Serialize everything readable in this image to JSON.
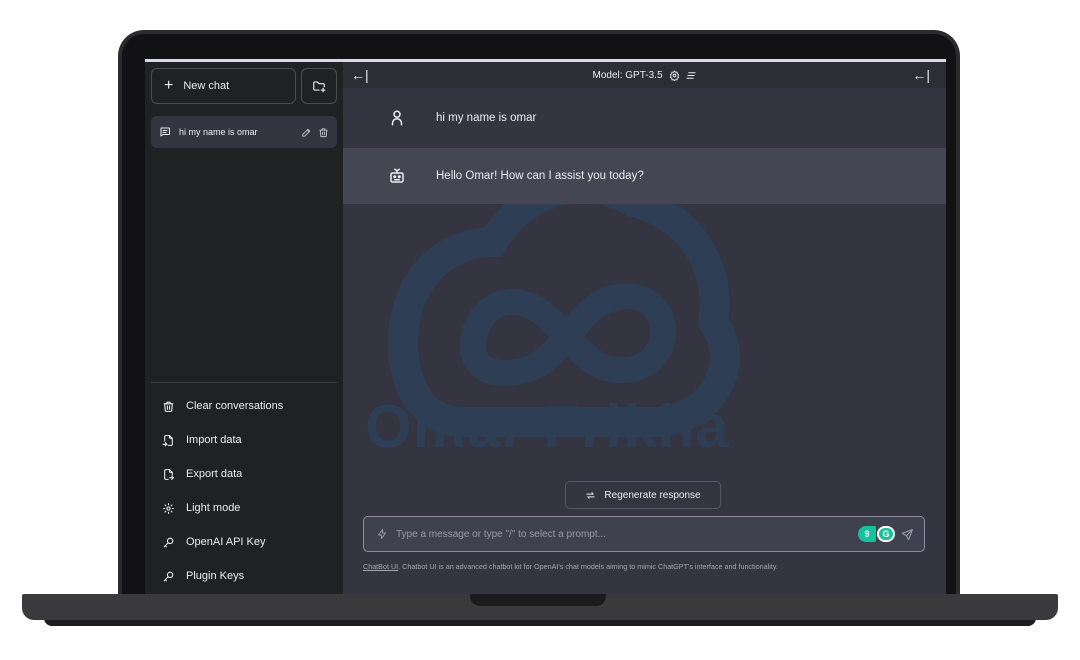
{
  "sidebar": {
    "new_chat_label": "New chat",
    "conversation": {
      "label": "hi my name is omar"
    },
    "menu": [
      {
        "label": "Clear conversations",
        "icon": "trash-icon"
      },
      {
        "label": "Import data",
        "icon": "file-import-icon"
      },
      {
        "label": "Export data",
        "icon": "file-export-icon"
      },
      {
        "label": "Light mode",
        "icon": "sun-icon"
      },
      {
        "label": "OpenAI API Key",
        "icon": "key-icon"
      },
      {
        "label": "Plugin Keys",
        "icon": "key-icon"
      }
    ]
  },
  "header": {
    "model_label": "Model: GPT-3.5"
  },
  "messages": [
    {
      "role": "user",
      "text": "hi my name is omar"
    },
    {
      "role": "assistant",
      "text": "Hello Omar! How can I assist you today?"
    }
  ],
  "watermark": {
    "text": "Omar Frikha"
  },
  "regenerate_label": "Regenerate response",
  "input": {
    "placeholder": "Type a message or type \"/\" to select a prompt...",
    "value": ""
  },
  "grammarly": {
    "badge_left": "9",
    "badge_right": "G"
  },
  "footer": {
    "link": "ChatBot UI",
    "text": ". Chatbot UI is an advanced chatbot kit for OpenAI's chat models aiming to mimic ChatGPT's interface and functionality."
  },
  "colors": {
    "sidebar_bg": "#202123",
    "main_bg": "#343541",
    "assistant_row_bg": "#444654",
    "watermark": "#2e3f55",
    "grammarly_green": "#15c39a"
  }
}
